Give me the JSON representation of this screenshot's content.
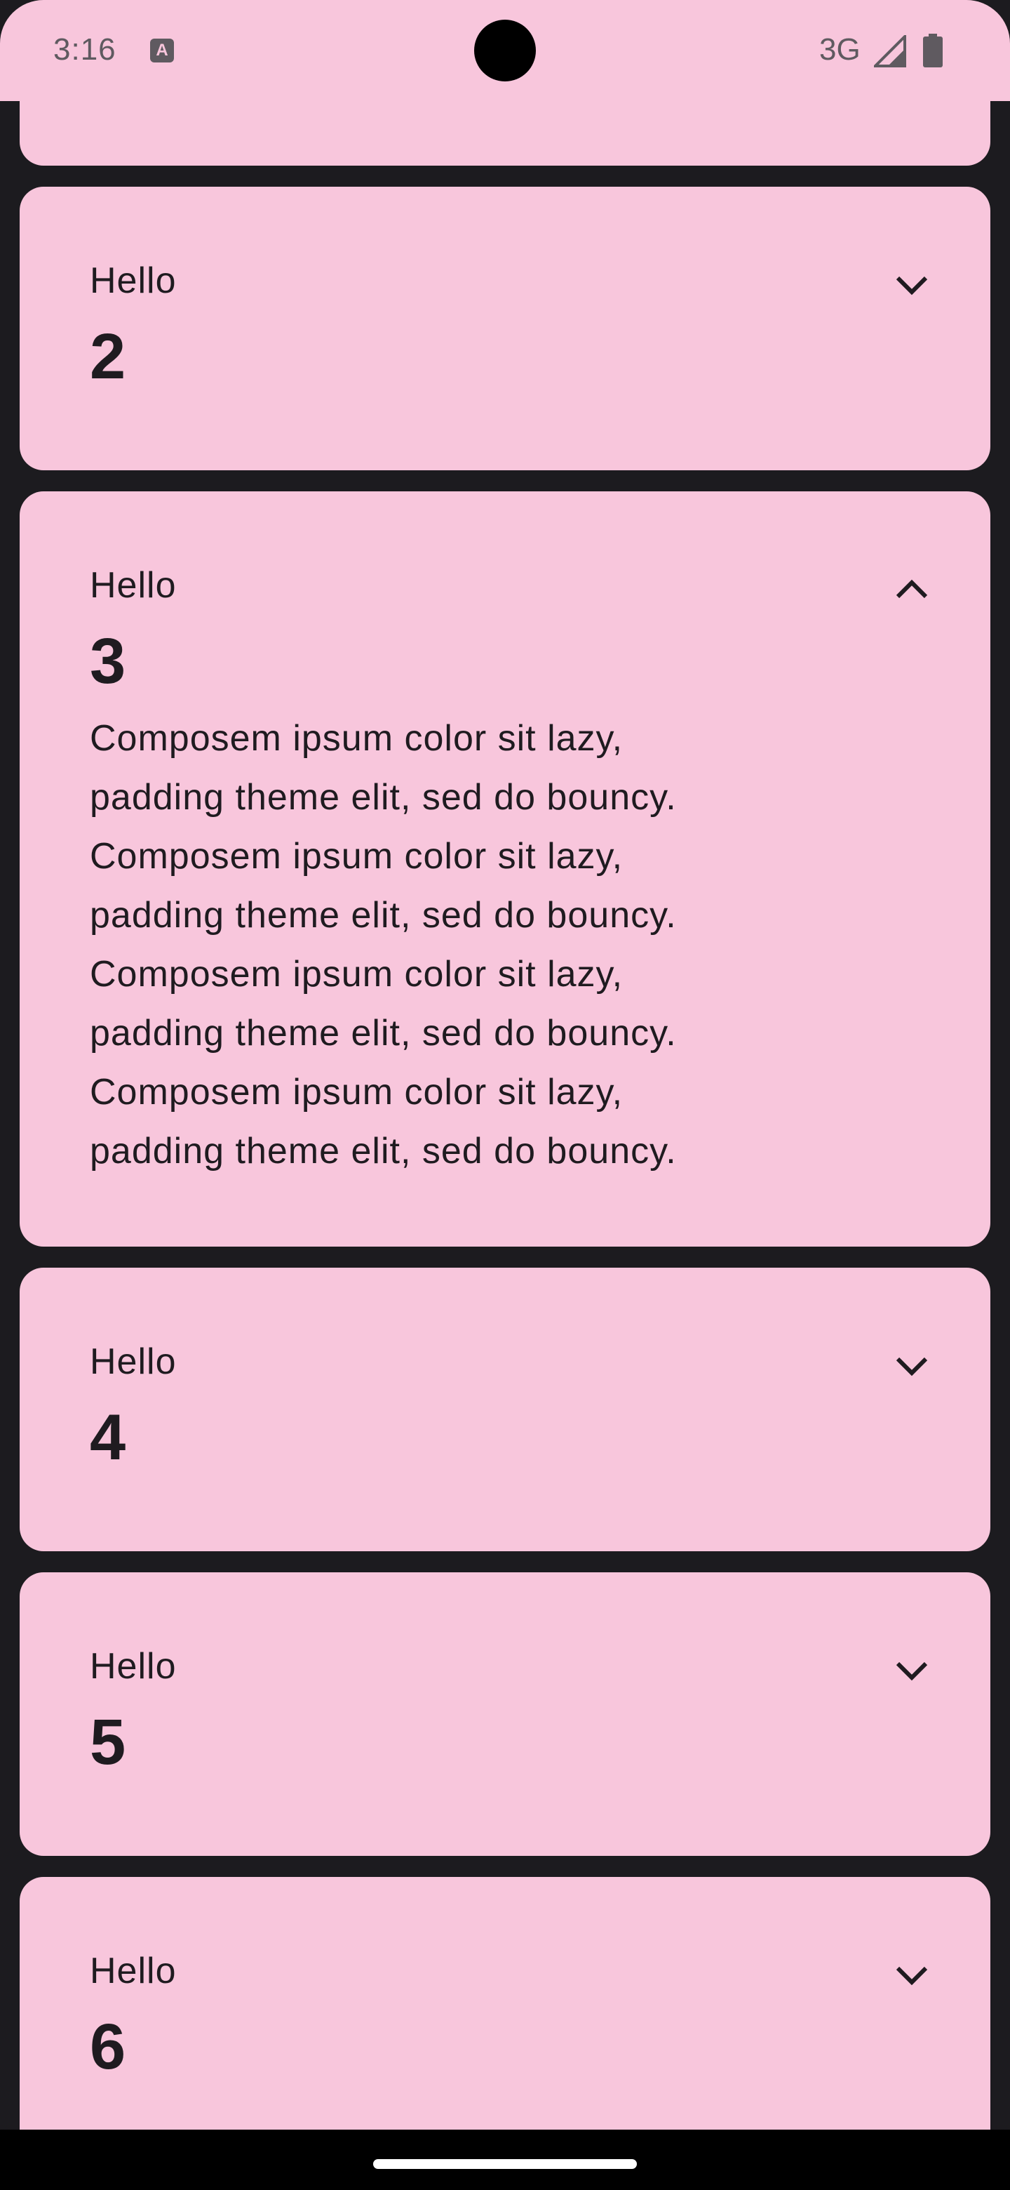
{
  "status_bar": {
    "time": "3:16",
    "network": "3G",
    "icons": [
      "a-notification-icon",
      "signal-icon",
      "battery-icon"
    ]
  },
  "colors": {
    "card_background": "#f8c6dc",
    "page_background": "#1c1b1f",
    "text": "#1f1b20"
  },
  "cards": [
    {
      "label": "Hello",
      "number": "2",
      "expanded": false,
      "toggle_icon": "chevron-down-icon"
    },
    {
      "label": "Hello",
      "number": "3",
      "expanded": true,
      "toggle_icon": "chevron-up-icon",
      "body_lines": [
        "Composem ipsum color sit lazy,",
        "padding theme elit, sed do bouncy.",
        "Composem ipsum color sit lazy,",
        "padding theme elit, sed do bouncy.",
        "Composem ipsum color sit lazy,",
        "padding theme elit, sed do bouncy.",
        "Composem ipsum color sit lazy,",
        "padding theme elit, sed do bouncy."
      ]
    },
    {
      "label": "Hello",
      "number": "4",
      "expanded": false,
      "toggle_icon": "chevron-down-icon"
    },
    {
      "label": "Hello",
      "number": "5",
      "expanded": false,
      "toggle_icon": "chevron-down-icon"
    },
    {
      "label": "Hello",
      "number": "6",
      "expanded": false,
      "toggle_icon": "chevron-down-icon"
    }
  ]
}
